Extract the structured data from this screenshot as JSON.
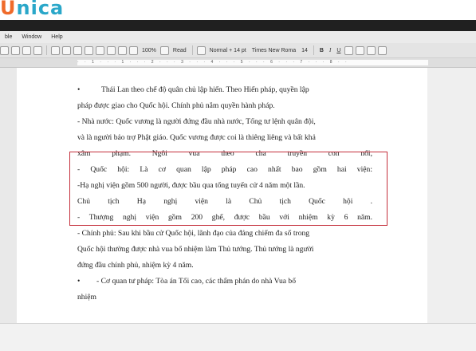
{
  "logo": {
    "first_letter": "U",
    "rest": "nica"
  },
  "menu": [
    "ble",
    "Window",
    "Help"
  ],
  "toolbar": {
    "zoom": "100%",
    "read_label": "Read",
    "style": "Normal + 14 pt",
    "font": "Times New Roma",
    "size": "14",
    "bold": "B",
    "italic": "I",
    "underline": "U"
  },
  "ruler": "· · 1 · · · 1 · · · 2 · · · 3 · · · 4 · · · 5 · · · 6 · · · 7 · · · 8 · ·",
  "document": {
    "lines": [
      {
        "text": "Thái Lan theo chế độ quân chủ lập hiến. Theo Hiến pháp, quyền lập",
        "bullet": "•",
        "indent": 30,
        "justify": false
      },
      {
        "text": "pháp được giao cho Quốc hội. Chính phủ nắm quyền hành pháp.",
        "bullet": "",
        "indent": 0,
        "justify": false
      },
      {
        "text": "- Nhà nước: Quốc vương là người đứng đầu nhà nước, Tổng tư lệnh quân đội,",
        "bullet": "",
        "indent": 0,
        "justify": false
      },
      {
        "text": "và là người bảo trợ Phật giáo. Quốc vương được coi là thiêng liêng và bất khả",
        "bullet": "",
        "indent": 0,
        "justify": false
      },
      {
        "text": "xâm phạm. Ngôi vua theo cha truyền con nối,",
        "bullet": "",
        "indent": 0,
        "justify": true
      },
      {
        "text": "- Quốc hội: Là cơ quan lập pháp cao nhất bao gồm hai viện:",
        "bullet": "",
        "indent": 0,
        "justify": true
      },
      {
        "text": "-Hạ nghị viện gồm 500 người, được bầu qua tổng tuyển cử 4 năm một lần.",
        "bullet": "",
        "indent": 0,
        "justify": false
      },
      {
        "text": "Chủ tịch Hạ nghị viện là Chủ tịch Quốc hội .",
        "bullet": "",
        "indent": 0,
        "justify": true
      },
      {
        "text": "- Thượng nghị viện gồm 200 ghế, được bầu với nhiệm kỳ 6 năm.",
        "bullet": "",
        "indent": 0,
        "justify": true
      },
      {
        "text": "- Chính phủ: Sau khi bầu cử Quốc hội, lãnh đạo của đảng chiếm đa số trong",
        "bullet": "",
        "indent": 0,
        "justify": false
      },
      {
        "text": "Quốc hội thường được nhà vua bổ nhiệm làm Thủ tướng. Thủ tướng là người",
        "bullet": "",
        "indent": 0,
        "justify": false
      },
      {
        "text": "đứng đầu chính phủ, nhiệm kỳ 4 năm.",
        "bullet": "",
        "indent": 0,
        "justify": false
      },
      {
        "text": "- Cơ quan tư pháp: Tòa án Tối cao, các thẩm phán do nhà Vua bổ",
        "bullet": "•",
        "indent": 24,
        "justify": false
      },
      {
        "text": "nhiệm",
        "bullet": "",
        "indent": 0,
        "justify": false
      }
    ]
  },
  "colors": {
    "logo_blue": "#2aa7c9",
    "logo_orange": "#ef6a2a",
    "highlight_red": "#c4303c"
  }
}
